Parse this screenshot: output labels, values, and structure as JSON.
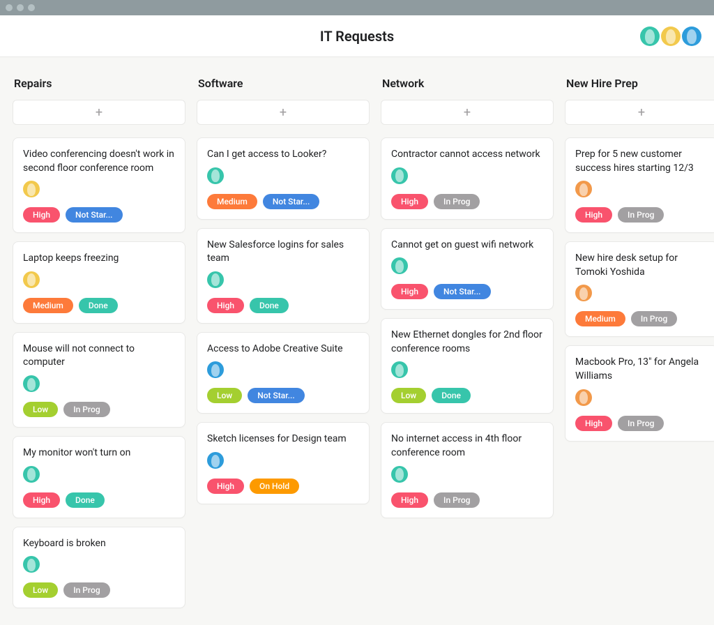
{
  "colors": {
    "priority": {
      "High": "#f9536d",
      "Medium": "#fd7a3a",
      "Low": "#a4cf30"
    },
    "status": {
      "Not Star...": "#4186e0",
      "In Prog": "#a2a0a2",
      "Done": "#37c5ab",
      "On Hold": "#fd9a00"
    },
    "avatar": {
      "yellow": "#f2c94c",
      "teal": "#37c5ab",
      "blue": "#2d9cdb",
      "orange": "#f2994a"
    }
  },
  "header": {
    "title": "IT Requests",
    "members": [
      "teal",
      "yellow",
      "blue"
    ]
  },
  "columns": [
    {
      "title": "Repairs",
      "cards": [
        {
          "title": "Video conferencing doesn't work in second floor conference room",
          "assignee": "yellow",
          "priority": "High",
          "status": "Not Star..."
        },
        {
          "title": "Laptop keeps freezing",
          "assignee": "yellow",
          "priority": "Medium",
          "status": "Done"
        },
        {
          "title": "Mouse will not connect to computer",
          "assignee": "teal",
          "priority": "Low",
          "status": "In Prog"
        },
        {
          "title": "My monitor won't turn on",
          "assignee": "teal",
          "priority": "High",
          "status": "Done"
        },
        {
          "title": "Keyboard is broken",
          "assignee": "teal",
          "priority": "Low",
          "status": "In Prog"
        }
      ]
    },
    {
      "title": "Software",
      "cards": [
        {
          "title": "Can I get access to Looker?",
          "assignee": "teal",
          "priority": "Medium",
          "status": "Not Star..."
        },
        {
          "title": "New Salesforce logins for sales team",
          "assignee": "teal",
          "priority": "High",
          "status": "Done"
        },
        {
          "title": "Access to Adobe Creative Suite",
          "assignee": "blue",
          "priority": "Low",
          "status": "Not Star..."
        },
        {
          "title": "Sketch licenses for Design team",
          "assignee": "blue",
          "priority": "High",
          "status": "On Hold"
        }
      ]
    },
    {
      "title": "Network",
      "cards": [
        {
          "title": "Contractor cannot access network",
          "assignee": "teal",
          "priority": "High",
          "status": "In Prog"
        },
        {
          "title": "Cannot get on guest wifi network",
          "assignee": "teal",
          "priority": "High",
          "status": "Not Star..."
        },
        {
          "title": "New Ethernet dongles for 2nd floor conference rooms",
          "assignee": "teal",
          "priority": "Low",
          "status": "Done"
        },
        {
          "title": "No internet access in 4th floor conference room",
          "assignee": "teal",
          "priority": "High",
          "status": "In Prog"
        }
      ]
    },
    {
      "title": "New Hire Prep",
      "cards": [
        {
          "title": "Prep for 5 new customer success hires starting 12/3",
          "assignee": "orange",
          "priority": "High",
          "status": "In Prog"
        },
        {
          "title": "New hire desk setup for Tomoki Yoshida",
          "assignee": "orange",
          "priority": "Medium",
          "status": "In Prog"
        },
        {
          "title": "Macbook Pro, 13\" for Angela Williams",
          "assignee": "orange",
          "priority": "High",
          "status": "In Prog"
        }
      ]
    }
  ]
}
